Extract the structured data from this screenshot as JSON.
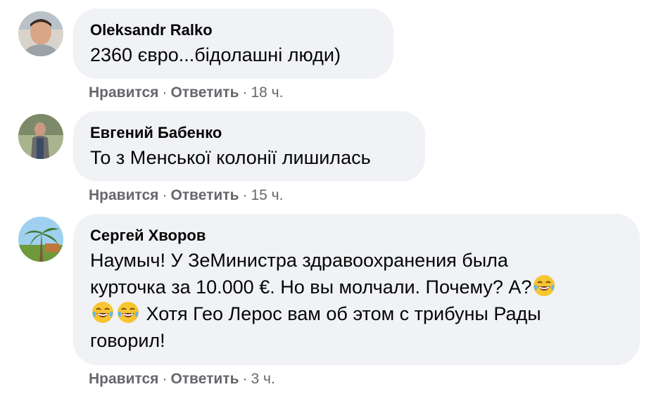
{
  "comments": [
    {
      "author": "Oleksandr Ralko",
      "text": "2360 євро...бідолашні люди)",
      "like_label": "Нравится",
      "reply_label": "Ответить",
      "time": "18 ч."
    },
    {
      "author": "Евгений Бабенко",
      "text": "То з Менської колонії лишилась",
      "like_label": "Нравится",
      "reply_label": "Ответить",
      "time": "15 ч."
    },
    {
      "author": "Сергей Хворов",
      "text_line1": "Наумыч! У ЗеМинистра здравоохранения была",
      "text_line2": "курточка за 10.000 €. Но вы молчали. Почему? А?",
      "text_line3": "Хотя Гео Лерос вам об этом с трибуны Рады",
      "text_line4": "говорил!",
      "like_label": "Нравится",
      "reply_label": "Ответить",
      "time": "3 ч."
    }
  ],
  "separator": "·",
  "emoji_icon": "face-with-tears-of-joy-icon"
}
